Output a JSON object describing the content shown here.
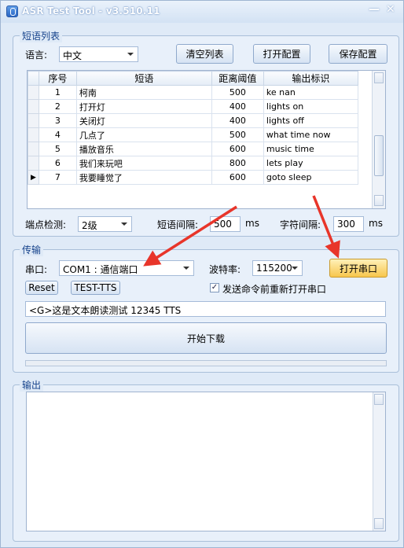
{
  "window": {
    "title": "ASR Test Tool - v3.510.11"
  },
  "titlebar": {
    "minimize": "—",
    "close": "✕"
  },
  "phrases": {
    "title": "短语列表",
    "language_label": "语言:",
    "language_value": "中文",
    "clear_button": "清空列表",
    "open_config_button": "打开配置",
    "save_config_button": "保存配置",
    "columns": [
      "序号",
      "短语",
      "距离阈值",
      "输出标识"
    ],
    "rows": [
      [
        "1",
        "柯南",
        "500",
        "ke nan"
      ],
      [
        "2",
        "打开灯",
        "400",
        "lights on"
      ],
      [
        "3",
        "关闭灯",
        "400",
        "lights off"
      ],
      [
        "4",
        "几点了",
        "500",
        "what time now"
      ],
      [
        "5",
        "播放音乐",
        "600",
        "music time"
      ],
      [
        "6",
        "我们来玩吧",
        "800",
        "lets play"
      ],
      [
        "7",
        "我要睡觉了",
        "600",
        "goto sleep"
      ]
    ],
    "current_row_marker": "▶",
    "endpoint_label": "端点检测:",
    "endpoint_value": "2级",
    "phrase_interval_label": "短语间隔:",
    "phrase_interval_value": "500",
    "phrase_interval_unit": "ms",
    "char_interval_label": "字符间隔:",
    "char_interval_value": "300",
    "char_interval_unit": "ms"
  },
  "transfer": {
    "title": "传输",
    "port_label": "串口:",
    "port_value": "COM1 : 通信端口",
    "baud_label": "波特率:",
    "baud_value": "115200",
    "open_port_button": "打开串口",
    "reset_button": "Reset",
    "tts_button": "TEST-TTS",
    "reopen_label": "发送命令前重新打开串口",
    "reopen_checked": "✓",
    "tts_text": "<G>这是文本朗读测试 12345 TTS",
    "download_button": "开始下载"
  },
  "output": {
    "title": "输出"
  },
  "colors": {
    "annotation_arrow": "#e8352a",
    "accent": "#15428b",
    "orange_button": "#f7c64d"
  }
}
